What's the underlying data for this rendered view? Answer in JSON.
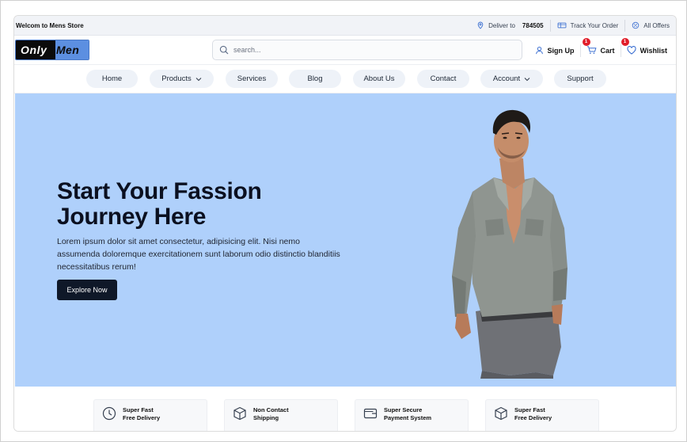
{
  "topbar": {
    "welcome": "Welcom to Mens Store",
    "deliver_label": "Deliver to",
    "pincode": "784505",
    "track_label": "Track Your Order",
    "offers_label": "All Offers"
  },
  "header": {
    "logo_part1": "Only",
    "logo_part2": "Men",
    "search_placeholder": "search...",
    "signup_label": "Sign Up",
    "cart_label": "Cart",
    "cart_count": "1",
    "wishlist_label": "Wishlist",
    "wishlist_count": "1"
  },
  "nav": {
    "items": [
      {
        "label": "Home",
        "dropdown": false
      },
      {
        "label": "Products",
        "dropdown": true
      },
      {
        "label": "Services",
        "dropdown": false
      },
      {
        "label": "Blog",
        "dropdown": false
      },
      {
        "label": "About Us",
        "dropdown": false
      },
      {
        "label": "Contact",
        "dropdown": false
      },
      {
        "label": "Account",
        "dropdown": true
      },
      {
        "label": "Support",
        "dropdown": false
      }
    ]
  },
  "hero": {
    "title_line1": "Start Your Fassion",
    "title_line2": "Journey Here",
    "text": "Lorem ipsum dolor sit amet consectetur, adipisicing elit. Nisi nemo assumenda doloremque exercitationem sunt laborum odio distinctio blanditiis necessitatibus rerum!",
    "button_label": "Explore Now",
    "bg_color": "#afd0fb"
  },
  "features": [
    {
      "line1": "Super Fast",
      "line2": "Free Delivery",
      "icon": "clock-icon"
    },
    {
      "line1": "Non Contact",
      "line2": "Shipping",
      "icon": "box-icon"
    },
    {
      "line1": "Super Secure",
      "line2": "Payment System",
      "icon": "wallet-icon"
    },
    {
      "line1": "Super Fast",
      "line2": "Free Delivery",
      "icon": "box-icon"
    }
  ]
}
